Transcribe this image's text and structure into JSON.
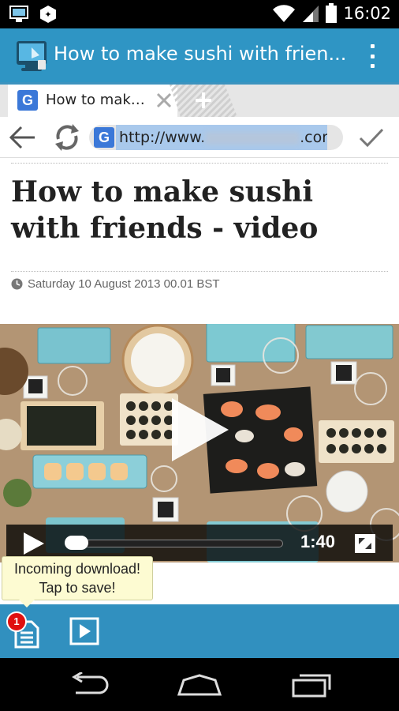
{
  "status_bar": {
    "time": "16:02"
  },
  "app_bar": {
    "title": "How to make sushi with frien..."
  },
  "tab": {
    "title": "How to mak…",
    "favicon": "G"
  },
  "url_bar": {
    "url_prefix": "http://www.",
    "url_suffix": ".com/",
    "favicon": "G"
  },
  "article": {
    "headline": "How to make sushi with friends - video",
    "date": "Saturday 10 August 2013 00.01 BST"
  },
  "video": {
    "duration": "1:40",
    "progress": 0.0
  },
  "tooltip": {
    "line1": "Incoming download!",
    "line2": "Tap to save!"
  },
  "bottom_bar": {
    "download_badge": "1"
  },
  "colors": {
    "accent": "#2f95c4",
    "toolbar": "#3190bf",
    "tooltip_bg": "#fdfbd2",
    "badge": "#e01010"
  }
}
